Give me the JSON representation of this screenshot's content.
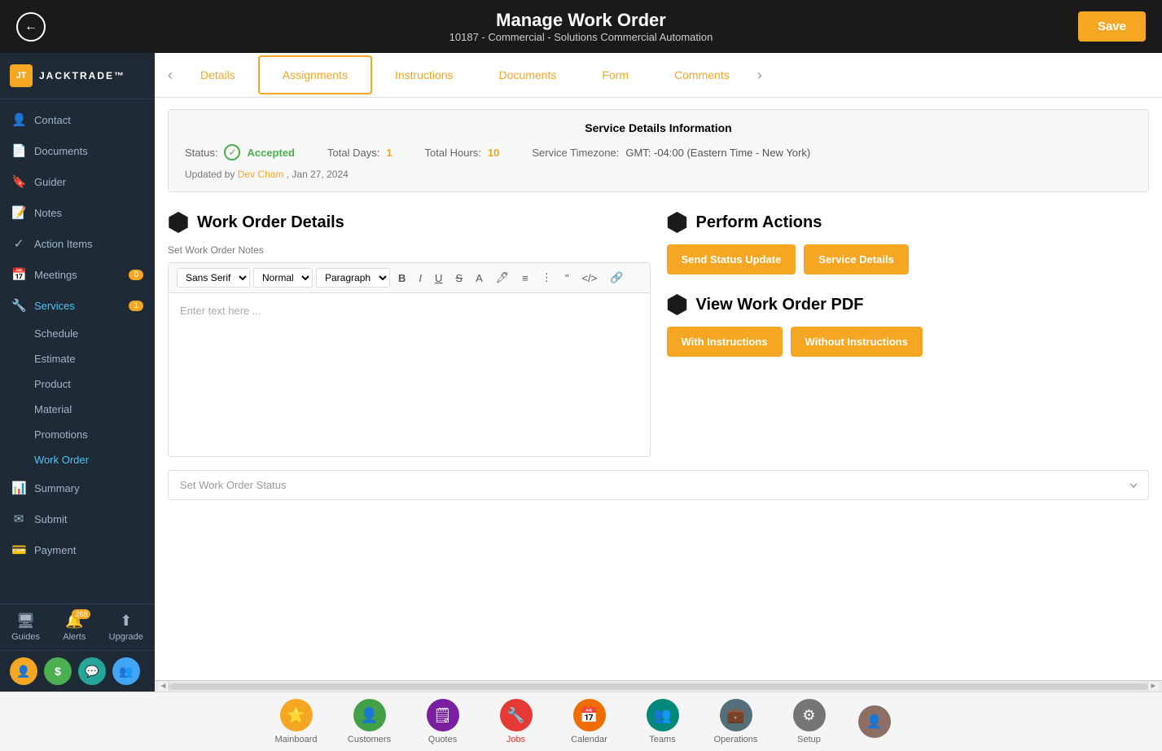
{
  "topBar": {
    "title": "Manage Work Order",
    "subtitle": "10187 - Commercial - Solutions Commercial Automation",
    "saveLabel": "Save",
    "backIcon": "‹"
  },
  "sidebar": {
    "logo": "JT",
    "logoText": "JACKTRADE™",
    "navItems": [
      {
        "id": "contact",
        "label": "Contact",
        "icon": "👤"
      },
      {
        "id": "documents",
        "label": "Documents",
        "icon": "📄"
      },
      {
        "id": "guider",
        "label": "Guider",
        "icon": "🔖"
      },
      {
        "id": "notes",
        "label": "Notes",
        "icon": "📝"
      },
      {
        "id": "action-items",
        "label": "Action Items",
        "icon": "✓"
      },
      {
        "id": "meetings",
        "label": "Meetings",
        "icon": "📅",
        "badge": "0"
      },
      {
        "id": "services",
        "label": "Services",
        "icon": "🔧",
        "badge": "1",
        "active": true
      },
      {
        "id": "summary",
        "label": "Summary",
        "icon": "📊"
      },
      {
        "id": "submit",
        "label": "Submit",
        "icon": "✉"
      },
      {
        "id": "payment",
        "label": "Payment",
        "icon": "💳"
      }
    ],
    "subItems": [
      {
        "id": "schedule",
        "label": "Schedule"
      },
      {
        "id": "estimate",
        "label": "Estimate"
      },
      {
        "id": "product",
        "label": "Product"
      },
      {
        "id": "material",
        "label": "Material"
      },
      {
        "id": "promotions",
        "label": "Promotions"
      },
      {
        "id": "work-order",
        "label": "Work Order",
        "active": true
      }
    ],
    "bottomItems": [
      {
        "id": "guides",
        "label": "Guides",
        "icon": "🖥"
      },
      {
        "id": "alerts",
        "label": "Alerts",
        "icon": "🔔",
        "badge": "268"
      },
      {
        "id": "upgrade",
        "label": "Upgrade",
        "icon": "⬆"
      }
    ],
    "footerIcons": [
      {
        "id": "user-icon",
        "icon": "👤",
        "color": "orange"
      },
      {
        "id": "dollar-icon",
        "icon": "$",
        "color": "green"
      },
      {
        "id": "chat-icon",
        "icon": "💬",
        "color": "teal"
      },
      {
        "id": "group-icon",
        "icon": "👥",
        "color": "blue"
      }
    ]
  },
  "tabs": [
    {
      "id": "details",
      "label": "Details"
    },
    {
      "id": "assignments",
      "label": "Assignments",
      "active": true
    },
    {
      "id": "instructions",
      "label": "Instructions"
    },
    {
      "id": "documents",
      "label": "Documents"
    },
    {
      "id": "form",
      "label": "Form"
    },
    {
      "id": "comments",
      "label": "Comments"
    }
  ],
  "serviceInfo": {
    "title": "Service Details Information",
    "statusLabel": "Status:",
    "statusValue": "Accepted",
    "totalDaysLabel": "Total Days:",
    "totalDaysValue": "1",
    "totalHoursLabel": "Total Hours:",
    "totalHoursValue": "10",
    "timezoneLabel": "Service Timezone:",
    "timezoneValue": "GMT: -04:00 (Eastern Time - New York)",
    "updatedLabel": "Updated by",
    "updatedBy": "Dev Cham",
    "updatedDate": ", Jan 27, 2024"
  },
  "workOrderDetails": {
    "sectionTitle": "Work Order Details",
    "notesLabel": "Set Work Order Notes",
    "editorPlaceholder": "Enter text here ...",
    "toolbar": {
      "font": "Sans Serif",
      "size": "Normal",
      "paragraph": "Paragraph"
    }
  },
  "performActions": {
    "sectionTitle": "Perform Actions",
    "sendStatusBtn": "Send Status Update",
    "serviceDetailsBtn": "Service Details"
  },
  "viewPDF": {
    "sectionTitle": "View Work Order PDF",
    "withInstructionsBtn": "With Instructions",
    "withoutInstructionsBtn": "Without Instructions"
  },
  "statusDropdown": {
    "placeholder": "Set Work Order Status"
  },
  "bottomNav": [
    {
      "id": "mainboard",
      "label": "Mainboard",
      "icon": "⭐",
      "colorClass": "icon-yellow"
    },
    {
      "id": "customers",
      "label": "Customers",
      "icon": "👤",
      "colorClass": "icon-green"
    },
    {
      "id": "quotes",
      "label": "Quotes",
      "icon": "🗒",
      "colorClass": "icon-purple"
    },
    {
      "id": "jobs",
      "label": "Jobs",
      "icon": "🔧",
      "colorClass": "icon-red",
      "active": true
    },
    {
      "id": "calendar",
      "label": "Calendar",
      "icon": "📅",
      "colorClass": "icon-orange"
    },
    {
      "id": "teams",
      "label": "Teams",
      "icon": "👥",
      "colorClass": "icon-teal"
    },
    {
      "id": "operations",
      "label": "Operations",
      "icon": "💼",
      "colorClass": "icon-blue-gray"
    },
    {
      "id": "setup",
      "label": "Setup",
      "icon": "⚙",
      "colorClass": "icon-gray"
    }
  ]
}
